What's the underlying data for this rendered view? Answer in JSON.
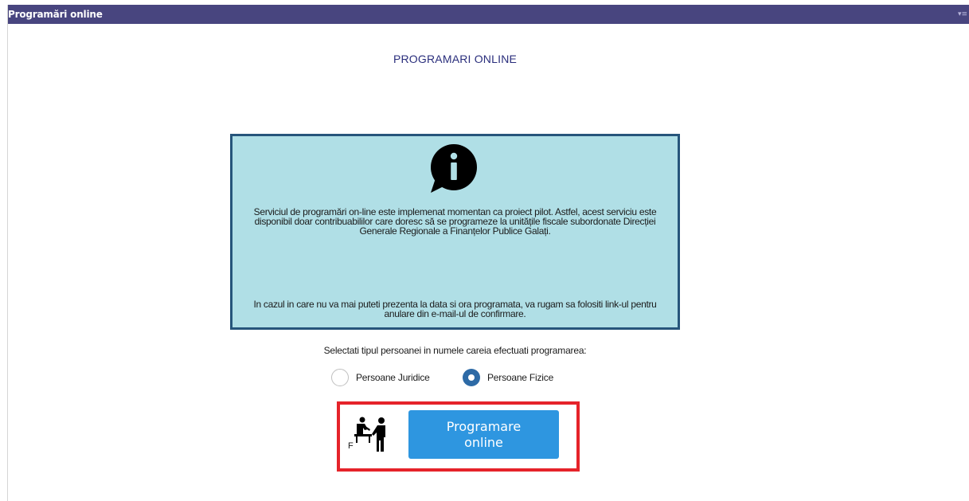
{
  "window": {
    "title": "Programări online",
    "menu_icon": "menu-icon"
  },
  "page": {
    "heading": "PROGRAMARI ONLINE"
  },
  "info": {
    "icon": "info-speech-bubble-icon",
    "paragraph1": "Serviciul de programări on-line este implemenat momentan ca proiect pilot. Astfel, acest serviciu este disponibil doar contribuabililor care doresc să se programeze la unitățile fiscale subordonate Direcției Generale Regionale a Finanțelor Publice Galați.",
    "paragraph2": "In cazul in care nu va mai puteti prezenta la data si ora programata, va rugam sa folositi link-ul pentru anulare din e-mail-ul de confirmare."
  },
  "person_type": {
    "prompt": "Selectati tipul persoanei in numele careia efectuati programarea:",
    "options": [
      {
        "label": "Persoane Juridice",
        "selected": false
      },
      {
        "label": "Persoane Fizice",
        "selected": true
      }
    ]
  },
  "action": {
    "icon": "people-at-desk-icon",
    "icon_letter": "F",
    "button_label": "Programare online"
  },
  "colors": {
    "titlebar": "#48457f",
    "info_background": "#b0dfe6",
    "info_border": "#26557b",
    "button": "#2e96e0",
    "radio_selected": "#2d6aa6",
    "highlight": "#e5232a"
  }
}
